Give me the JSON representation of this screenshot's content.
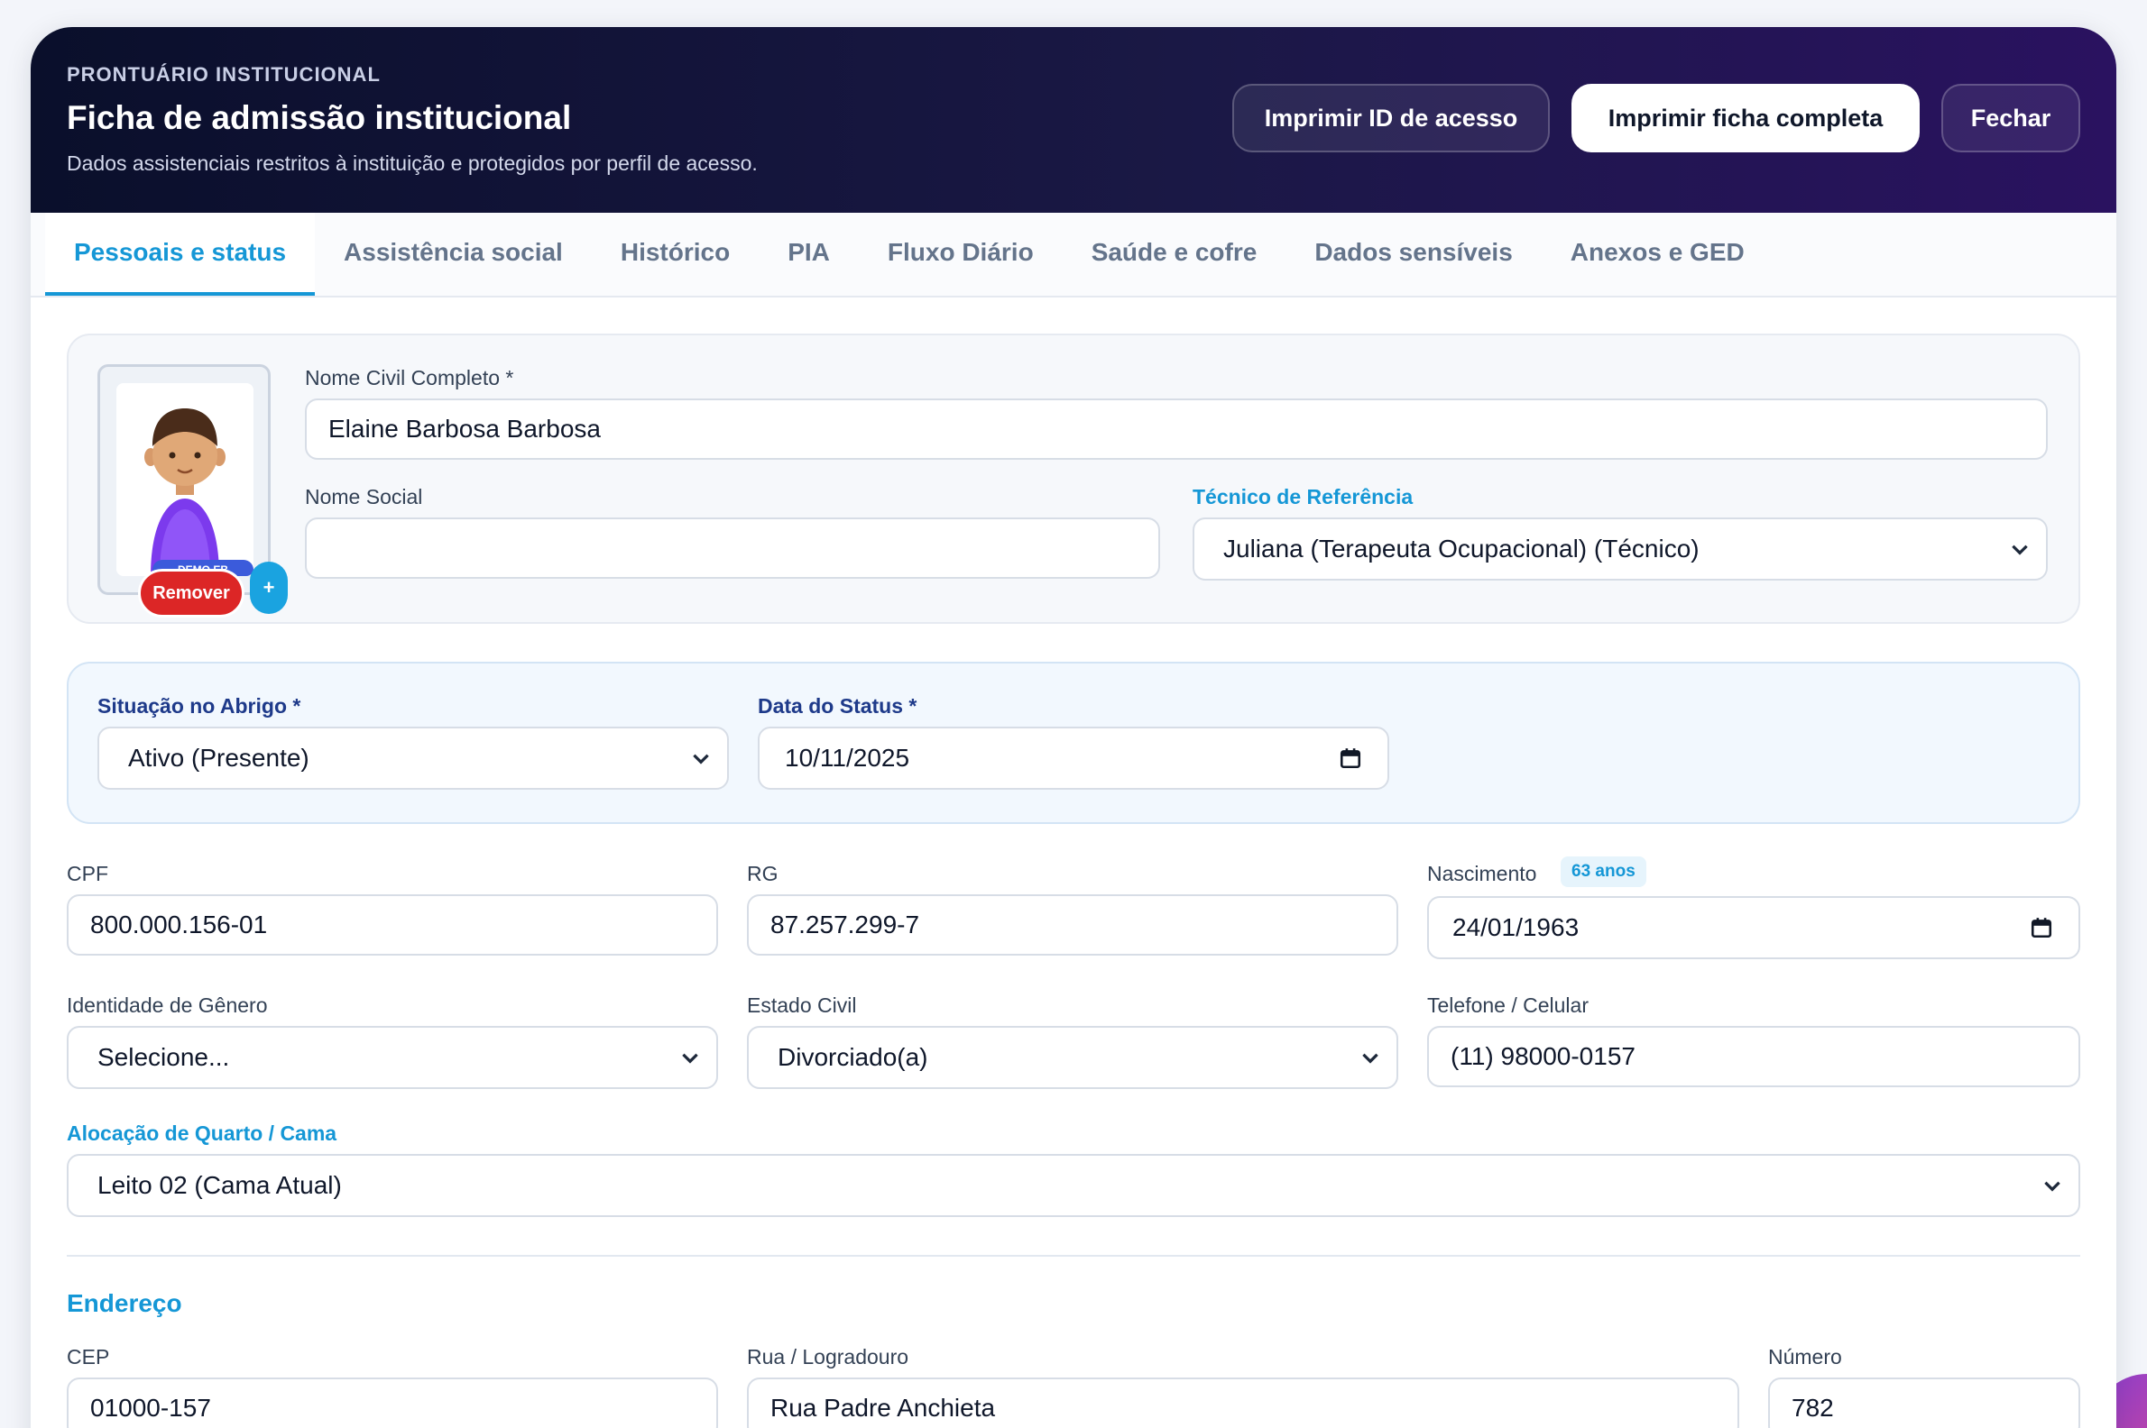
{
  "header": {
    "kicker": "PRONTUÁRIO INSTITUCIONAL",
    "title": "Ficha de admissão institucional",
    "subtitle": "Dados assistenciais restritos à instituição e protegidos por perfil de acesso.",
    "actions": {
      "print_id": "Imprimir ID de acesso",
      "print_full": "Imprimir ficha completa",
      "close": "Fechar"
    }
  },
  "tabs": [
    {
      "label": "Pessoais e status",
      "active": true
    },
    {
      "label": "Assistência social"
    },
    {
      "label": "Histórico"
    },
    {
      "label": "PIA"
    },
    {
      "label": "Fluxo Diário"
    },
    {
      "label": "Saúde e cofre"
    },
    {
      "label": "Dados sensíveis"
    },
    {
      "label": "Anexos e GED"
    }
  ],
  "identity": {
    "photo": {
      "tag": "DEMO EB",
      "remove_label": "Remover",
      "add_label": "+"
    },
    "full_name": {
      "label": "Nome Civil Completo *",
      "value": "Elaine Barbosa Barbosa"
    },
    "social_name": {
      "label": "Nome Social",
      "value": ""
    },
    "reference_tech": {
      "label": "Técnico de Referência",
      "value": "Juliana (Terapeuta Ocupacional) (Técnico)"
    }
  },
  "status": {
    "situation": {
      "label": "Situação no Abrigo *",
      "value": "Ativo (Presente)"
    },
    "status_date": {
      "label": "Data do Status *",
      "value": "10/11/2025"
    }
  },
  "personal": {
    "cpf": {
      "label": "CPF",
      "value": "800.000.156-01"
    },
    "rg": {
      "label": "RG",
      "value": "87.257.299-7"
    },
    "birth": {
      "label": "Nascimento",
      "age_badge": "63 anos",
      "value": "24/01/1963"
    },
    "gender": {
      "label": "Identidade de Gênero",
      "value": "Selecione..."
    },
    "marital": {
      "label": "Estado Civil",
      "value": "Divorciado(a)"
    },
    "phone": {
      "label": "Telefone / Celular",
      "value": "(11) 98000-0157"
    },
    "room": {
      "label": "Alocação de Quarto / Cama",
      "value": "Leito 02 (Cama Atual)"
    }
  },
  "address": {
    "section_title": "Endereço",
    "cep": {
      "label": "CEP",
      "value": "01000-157"
    },
    "street": {
      "label": "Rua / Logradouro",
      "value": "Rua Padre Anchieta"
    },
    "number": {
      "label": "Número",
      "value": "782"
    }
  },
  "colors": {
    "accent": "#1597d6",
    "danger": "#dc2626",
    "header_dark": "#0a0f2b",
    "header_purple": "#2a1260"
  }
}
